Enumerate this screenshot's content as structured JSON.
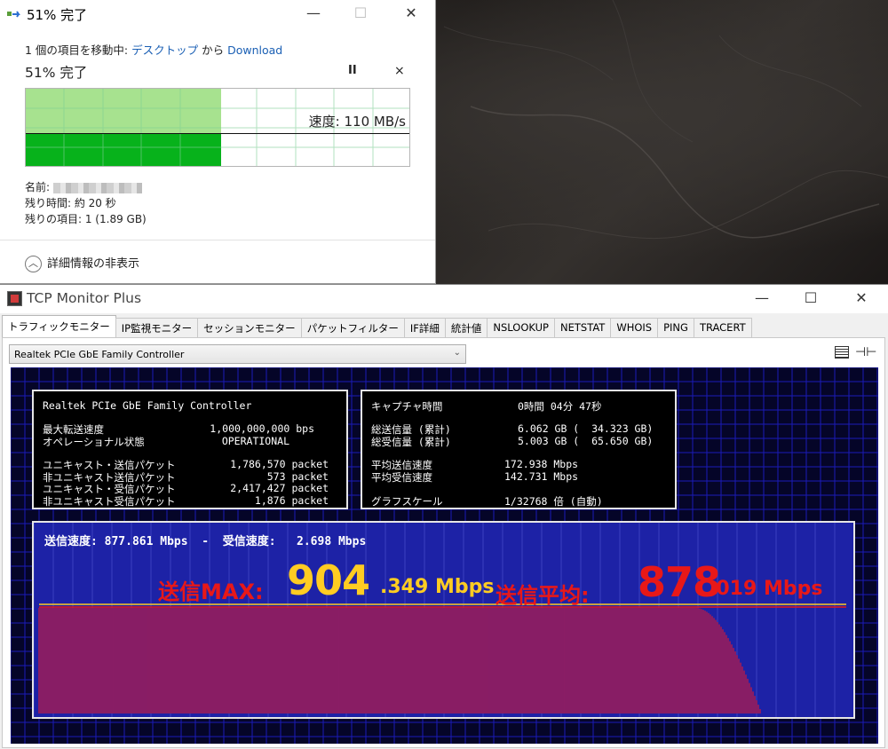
{
  "copy_dialog": {
    "title": "51% 完了",
    "move_prefix": "1 個の項目を移動中: ",
    "move_from": "デスクトップ",
    "move_mid": " から ",
    "move_to": "Download",
    "status_title": "51% 完了",
    "pause_label": "II",
    "cancel_label": "×",
    "speed_label": "速度: 110 MB/s",
    "progress_fraction": 0.51,
    "name_label": "名前:",
    "remaining_time": "残り時間: 約 20 秒",
    "remaining_items": "残りの項目: 1 (1.89 GB)",
    "details_toggle": "詳細情報の非表示",
    "window_controls": {
      "minimize": "—",
      "maximize": "☐",
      "close": "✕"
    }
  },
  "tcp_monitor": {
    "title": "TCP Monitor Plus",
    "window_controls": {
      "minimize": "—",
      "maximize": "☐",
      "close": "✕"
    },
    "tabs": [
      "トラフィックモニター",
      "IP監視モニター",
      "セッションモニター",
      "パケットフィルター",
      "IF詳細",
      "統計値",
      "NSLOOKUP",
      "NETSTAT",
      "WHOIS",
      "PING",
      "TRACERT"
    ],
    "active_tab": 0,
    "adapter": "Realtek PCIe GbE Family Controller",
    "stats_left": {
      "heading": "Realtek PCIe GbE Family Controller",
      "rows": [
        {
          "label": "最大転送速度",
          "value": "1,000,000,000 bps"
        },
        {
          "label": "オペレーショナル状態",
          "value": "OPERATIONAL"
        },
        {
          "label": "ユニキャスト・送信パケット",
          "value": "1,786,570 packet"
        },
        {
          "label": "非ユニキャスト送信パケット",
          "value": "573 packet"
        },
        {
          "label": "ユニキャスト・受信パケット",
          "value": "2,417,427 packet"
        },
        {
          "label": "非ユニキャスト受信パケット",
          "value": "1,876 packet"
        }
      ]
    },
    "stats_right": {
      "rows": [
        {
          "label": "キャプチャ時間",
          "value": "0時間 04分 47秒"
        },
        {
          "label": "総送信量 (累計)",
          "value": "6.062 GB (  34.323 GB)"
        },
        {
          "label": "総受信量 (累計)",
          "value": "5.003 GB (  65.650 GB)"
        },
        {
          "label": "平均送信速度",
          "value": "172.938 Mbps"
        },
        {
          "label": "平均受信速度",
          "value": "142.731 Mbps"
        },
        {
          "label": "グラフスケール",
          "value": "1/32768 倍 (自動)"
        }
      ]
    },
    "speed_line": "送信速度: 877.861 Mbps  -  受信速度:   2.698 Mbps",
    "max_label": "送信MAX:",
    "max_int": "904",
    "max_frac": ".349 Mbps",
    "avg_label": "送信平均:",
    "avg_int": "878",
    "avg_frac": ".019 Mbps",
    "colors": {
      "max": "#ffcc22",
      "avg": "#e81818",
      "panel": "#1d22a6"
    }
  }
}
